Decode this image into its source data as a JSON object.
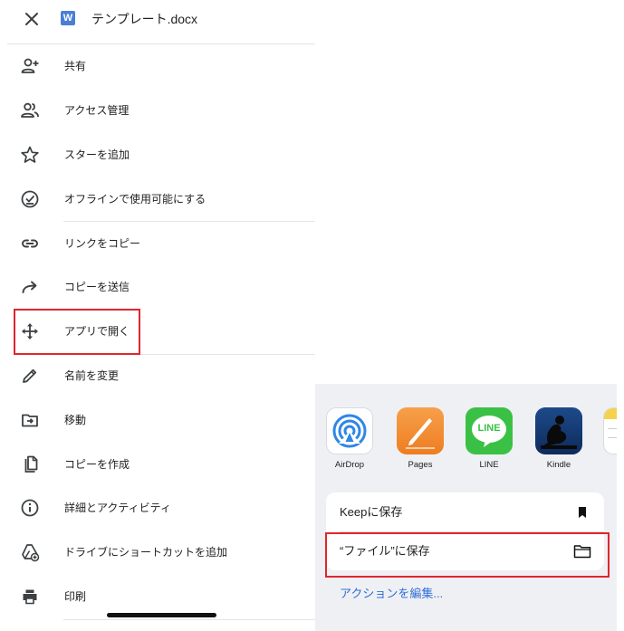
{
  "header": {
    "close_icon": "close-icon",
    "file_badge": "W",
    "file_title": "テンプレート.docx"
  },
  "menu": {
    "items": [
      {
        "label": "共有",
        "icon": "person-add-icon"
      },
      {
        "label": "アクセス管理",
        "icon": "people-icon"
      },
      {
        "label": "スターを追加",
        "icon": "star-icon"
      },
      {
        "label": "オフラインで使用可能にする",
        "icon": "offline-check-icon"
      },
      {
        "label": "リンクをコピー",
        "icon": "link-icon"
      },
      {
        "label": "コピーを送信",
        "icon": "share-arrow-icon"
      },
      {
        "label": "アプリで開く",
        "icon": "open-with-icon",
        "highlighted": true
      },
      {
        "label": "名前を変更",
        "icon": "pencil-icon"
      },
      {
        "label": "移動",
        "icon": "move-folder-icon"
      },
      {
        "label": "コピーを作成",
        "icon": "copy-icon"
      },
      {
        "label": "詳細とアクティビティ",
        "icon": "info-icon"
      },
      {
        "label": "ドライブにショートカットを追加",
        "icon": "drive-shortcut-icon"
      },
      {
        "label": "印刷",
        "icon": "print-icon"
      }
    ]
  },
  "share_sheet": {
    "apps": [
      {
        "label": "AirDrop",
        "icon": "airdrop-icon"
      },
      {
        "label": "Pages",
        "icon": "pages-icon"
      },
      {
        "label": "LINE",
        "icon": "line-icon",
        "badge": "LINE"
      },
      {
        "label": "Kindle",
        "icon": "kindle-icon"
      },
      {
        "label": "",
        "icon": "notes-icon"
      }
    ],
    "actions": [
      {
        "label": "Keepに保存",
        "icon": "bookmark-icon"
      },
      {
        "label": "“ファイル”に保存",
        "icon": "folder-icon",
        "highlighted": true
      }
    ],
    "edit_actions_label": "アクションを編集..."
  },
  "colors": {
    "highlight": "#e0262d",
    "link": "#2f6fd6",
    "word_blue": "#4a7fd4",
    "sheet_bg": "#eff0f4"
  }
}
